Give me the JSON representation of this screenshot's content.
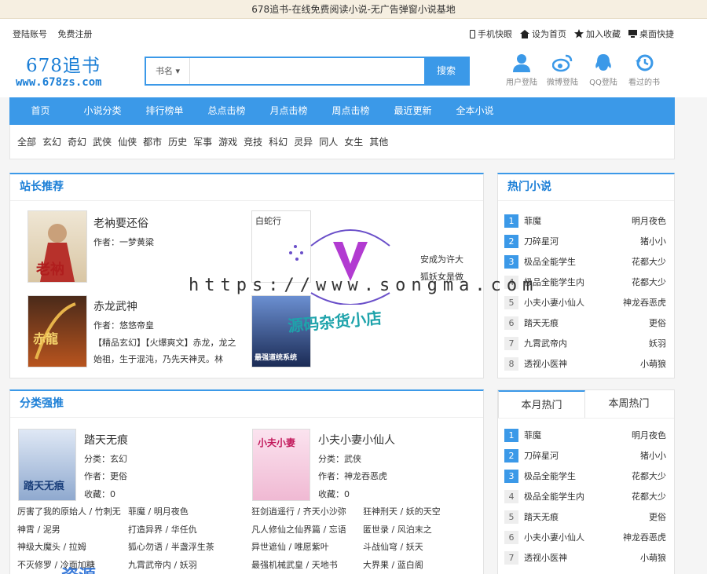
{
  "topbar": {
    "title": "678追书-在线免费阅读小说-无广告弹窗小说基地"
  },
  "userbar": {
    "login": "登陆账号",
    "register": "免费注册",
    "mobile": "手机快眼",
    "home": "设为首页",
    "fav": "加入收藏",
    "desktop": "桌面快捷"
  },
  "logo": {
    "name": "678追书",
    "url": "www.678zs.com"
  },
  "search": {
    "type": "书名",
    "button": "搜索"
  },
  "icons": {
    "user": "用户登陆",
    "weibo": "微博登陆",
    "qq": "QQ登陆",
    "history": "看过的书"
  },
  "nav": [
    "首页",
    "小说分类",
    "排行榜单",
    "总点击榜",
    "月点击榜",
    "周点击榜",
    "最近更新",
    "全本小说"
  ],
  "cats": [
    "全部",
    "玄幻",
    "奇幻",
    "武侠",
    "仙侠",
    "都市",
    "历史",
    "军事",
    "游戏",
    "竞技",
    "科幻",
    "灵异",
    "同人",
    "女生",
    "其他"
  ],
  "recommend": {
    "title": "站长推荐",
    "b1": {
      "title": "老衲要还俗",
      "author": "作者：一梦黄粱"
    },
    "b2": {
      "alt": "白蛇行",
      "d1": "安成为许大",
      "d2": "狐妖女是做"
    },
    "b3": {
      "title": "赤龙武神",
      "author": "作者：悠悠帝皇",
      "desc": "【精品玄幻】【火爆爽文】赤龙，龙之始祖，生于混沌，乃先天神灵。林"
    },
    "b4": {
      "caption": "最强道统系统"
    }
  },
  "hot": {
    "title": "热门小说",
    "items": [
      {
        "n": "1",
        "name": "菲魔",
        "author": "明月夜色"
      },
      {
        "n": "2",
        "name": "刀碎星河",
        "author": "猪小小"
      },
      {
        "n": "3",
        "name": "极品全能学生",
        "author": "花都大少"
      },
      {
        "n": "4",
        "name": "极品全能学生内",
        "author": "花都大少"
      },
      {
        "n": "5",
        "name": "小夫小妻小仙人",
        "author": "神龙吞恶虎"
      },
      {
        "n": "6",
        "name": "踏天无痕",
        "author": "更俗"
      },
      {
        "n": "7",
        "name": "九霄武帝内",
        "author": "妖羽"
      },
      {
        "n": "8",
        "name": "透视小医神",
        "author": "小萌狼"
      }
    ]
  },
  "catrec": {
    "title": "分类强推",
    "b1": {
      "title": "踏天无痕",
      "cat": "分类：玄幻",
      "author": "作者：更俗",
      "fav": "收藏：0",
      "cover": "踏天无痕"
    },
    "b2": {
      "title": "小夫小妻小仙人",
      "cat": "分类：武侠",
      "author": "作者：神龙吞恶虎",
      "fav": "收藏：0",
      "cover": "小夫小妻"
    },
    "links": [
      [
        "厉害了我的原始人 / 竹刺无",
        "菲魔 / 明月夜色",
        "狂剑逍遥行 / 齐天小沙弥",
        "狂神刑天 / 妖的天空"
      ],
      [
        "神霄 / 泥男",
        "打造异界 / 华任仇",
        "凡人修仙之仙界篇 / 忘语",
        "匿世录 / 风泊末之"
      ],
      [
        "神级大魔头 / 拉姆",
        "狐心勿语 / 半盏浮生茶",
        "异世遮仙 / 唯愿紫叶",
        "斗战仙穹 / 妖天"
      ],
      [
        "不灭修罗 / 冷面加糖",
        "九霄武帝内 / 妖羽",
        "最强机械武皇 / 天地书",
        "大界果 / 蓝白阁"
      ]
    ]
  },
  "monthly": {
    "tab1": "本月热门",
    "tab2": "本周热门",
    "items": [
      {
        "n": "1",
        "name": "菲魔",
        "author": "明月夜色"
      },
      {
        "n": "2",
        "name": "刀碎星河",
        "author": "猪小小"
      },
      {
        "n": "3",
        "name": "极品全能学生",
        "author": "花都大少"
      },
      {
        "n": "4",
        "name": "极品全能学生内",
        "author": "花都大少"
      },
      {
        "n": "5",
        "name": "踏天无痕",
        "author": "更俗"
      },
      {
        "n": "6",
        "name": "小夫小妻小仙人",
        "author": "神龙吞恶虎"
      },
      {
        "n": "7",
        "name": "透视小医神",
        "author": "小萌狼"
      }
    ]
  },
  "watermark": {
    "url": "https://www.songma.com",
    "shop": "源码杂货小店",
    "bottom": "资源"
  }
}
